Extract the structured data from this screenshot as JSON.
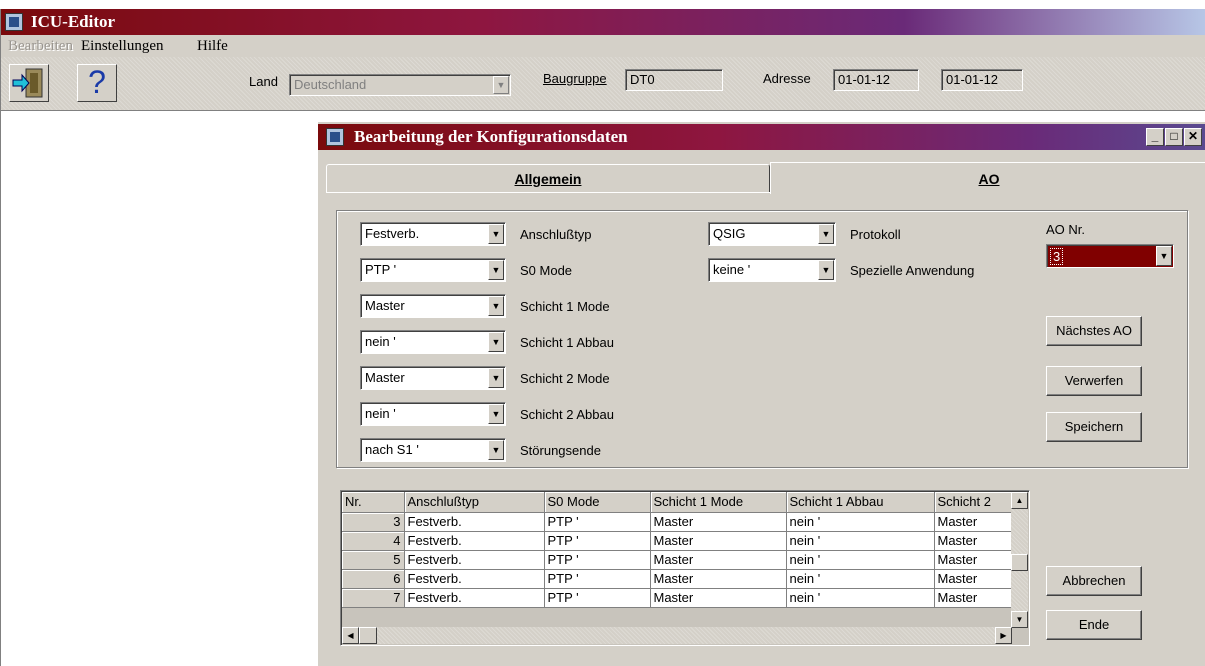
{
  "app": {
    "title": "ICU-Editor"
  },
  "menu": {
    "items": [
      "Bearbeiten",
      "Einstellungen",
      "Hilfe"
    ]
  },
  "toolbar": {
    "land_label": "Land",
    "land_value": "Deutschland",
    "baugruppe_label": "Baugruppe",
    "baugruppe_value": "DT0",
    "adresse_label": "Adresse",
    "adresse_value1": "01-01-12",
    "adresse_value2": "01-01-12",
    "help_glyph": "?"
  },
  "dialog": {
    "title": "Bearbeitung der Konfigurationsdaten",
    "tabs": [
      "Allgemein",
      "AO"
    ],
    "fields": [
      {
        "value": "Festverb.",
        "label": "Anschlußtyp"
      },
      {
        "value": "PTP '",
        "label": "S0 Mode"
      },
      {
        "value": "Master",
        "label": "Schicht 1 Mode"
      },
      {
        "value": "nein '",
        "label": "Schicht 1 Abbau"
      },
      {
        "value": "Master",
        "label": "Schicht 2 Mode"
      },
      {
        "value": "nein '",
        "label": "Schicht 2 Abbau"
      },
      {
        "value": "nach S1 '",
        "label": "Störungsende"
      }
    ],
    "fields2": [
      {
        "value": "QSIG",
        "label": "Protokoll"
      },
      {
        "value": "keine '",
        "label": "Spezielle Anwendung"
      }
    ],
    "ao_nr_label": "AO Nr.",
    "ao_nr_value": "3",
    "buttons": {
      "next": "Nächstes AO",
      "discard": "Verwerfen",
      "save": "Speichern",
      "cancel": "Abbrechen",
      "end": "Ende"
    },
    "grid": {
      "headers": [
        "Nr.",
        "Anschlußtyp",
        "S0 Mode",
        "Schicht 1 Mode",
        "Schicht 1 Abbau",
        "Schicht 2"
      ],
      "rows": [
        [
          "3",
          "Festverb.",
          "PTP '",
          "Master",
          "nein '",
          "Master"
        ],
        [
          "4",
          "Festverb.",
          "PTP '",
          "Master",
          "nein '",
          "Master"
        ],
        [
          "5",
          "Festverb.",
          "PTP '",
          "Master",
          "nein '",
          "Master"
        ],
        [
          "6",
          "Festverb.",
          "PTP '",
          "Master",
          "nein '",
          "Master"
        ],
        [
          "7",
          "Festverb.",
          "PTP '",
          "Master",
          "nein '",
          "Master"
        ]
      ]
    }
  },
  "colors": {
    "title_start": "#7a0a0c",
    "title_end": "#b7c6e6",
    "ao_select_bg": "#800000"
  }
}
